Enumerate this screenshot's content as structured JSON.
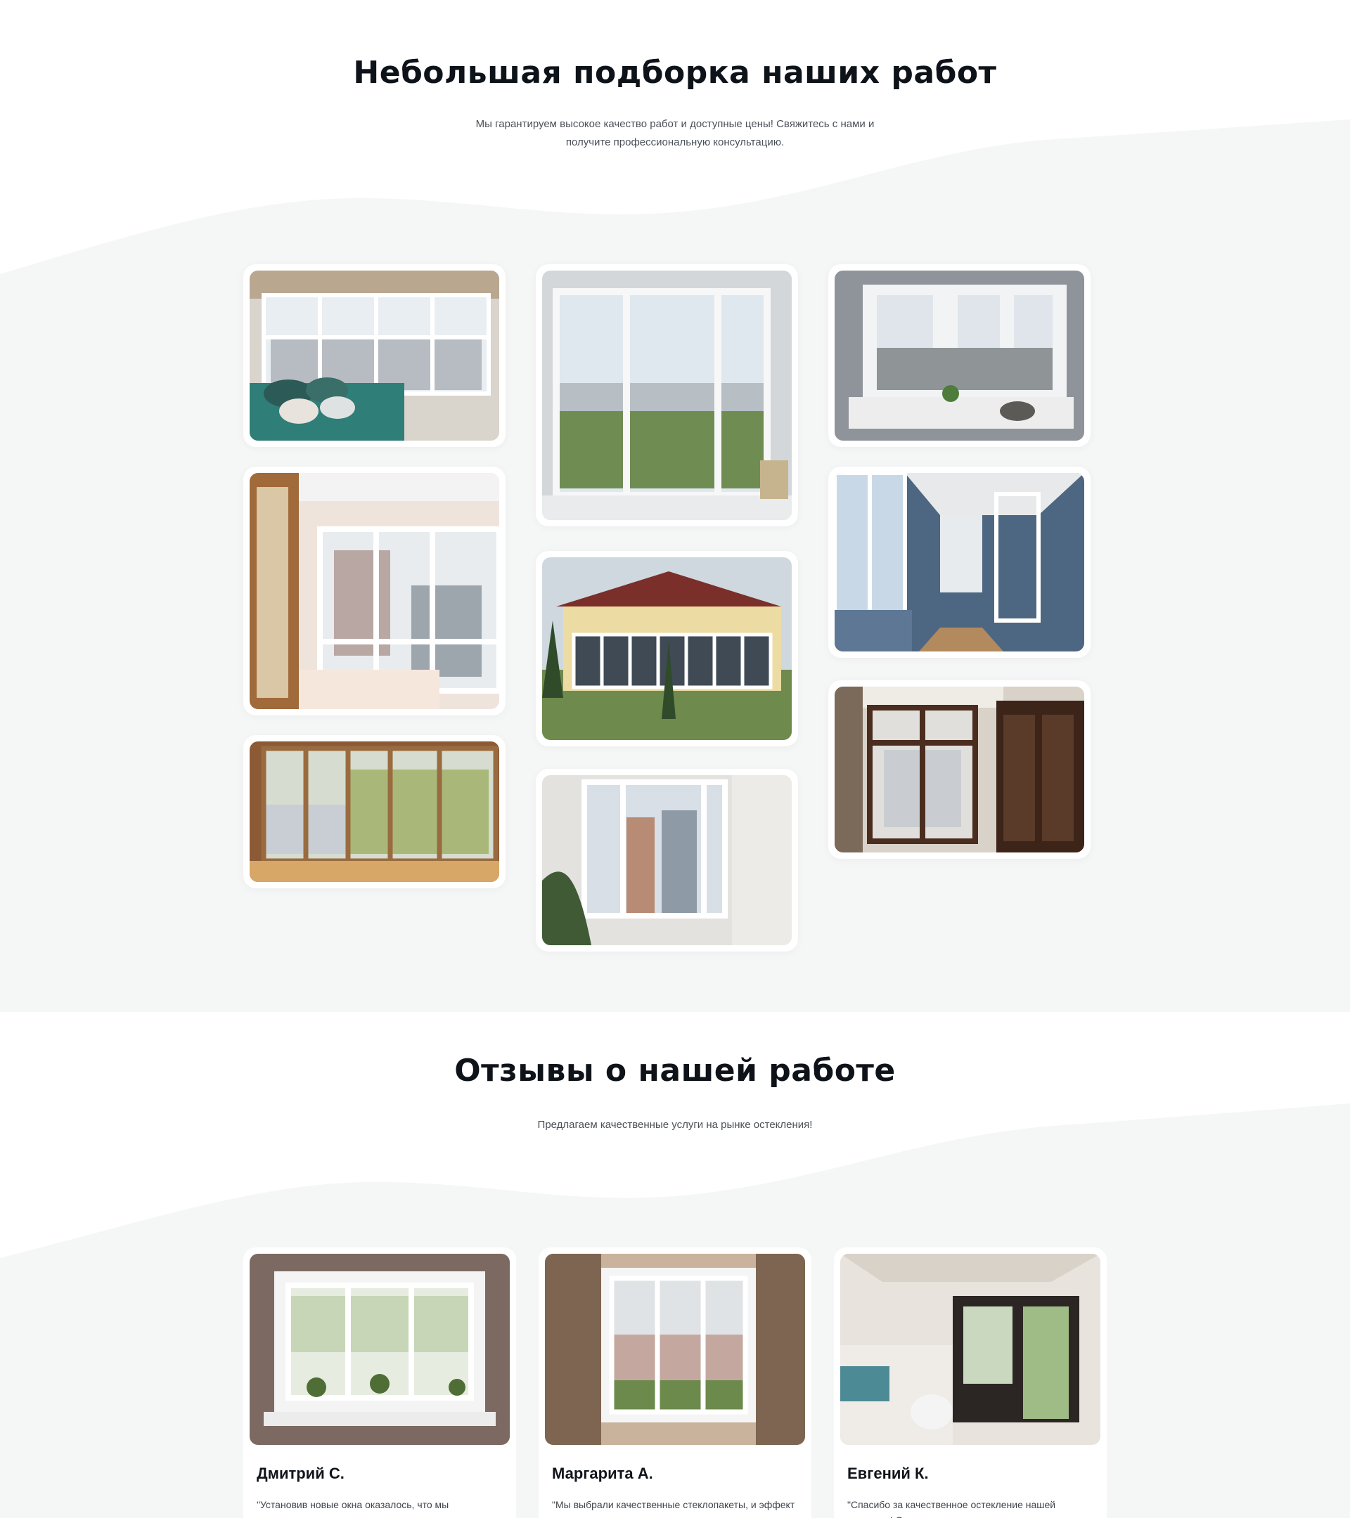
{
  "gallery": {
    "title": "Небольшая подборка наших работ",
    "subtitle": "Мы гарантируем высокое качество работ и доступные цены! Свяжитесь с нами и получите профессиональную консультацию."
  },
  "reviews": {
    "title": "Отзывы о нашей работе",
    "subtitle": "Предлагаем качественные услуги на рынке остекления!",
    "items": [
      {
        "name": "Дмитрий С.",
        "text": "\"Установив новые окна оказалось, что мы сэкономили на отоплении, уменьшили шум с"
      },
      {
        "name": "Маргарита А.",
        "text": "\"Мы выбрали качественные стеклопакеты, и эффект оказался сразу заметен: наличие"
      },
      {
        "name": "Евгений К.",
        "text": "\"Спасибо за качественное остекление нашей квартиры! Окна выглядят отлично, никаких"
      }
    ]
  },
  "colors": {
    "heading": "#0e1319",
    "body_text": "#4a5058",
    "wave": "#f5f6f6",
    "card": "#ffffff"
  }
}
